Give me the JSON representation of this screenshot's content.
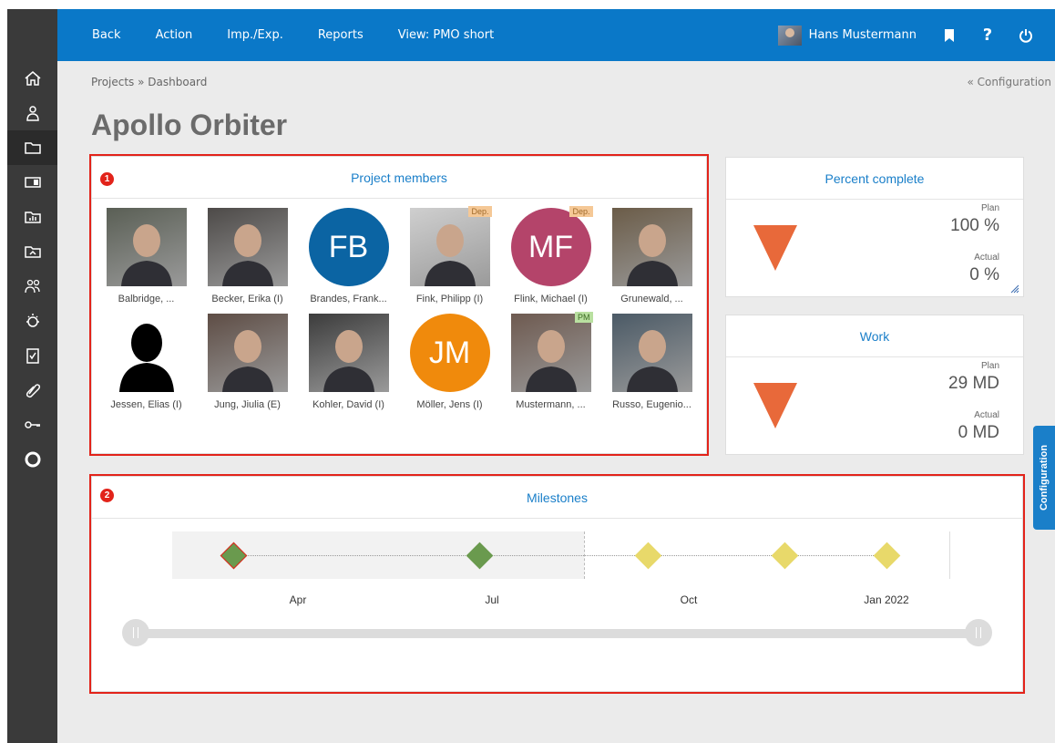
{
  "topbar": {
    "menu": [
      "Back",
      "Action",
      "Imp./Exp.",
      "Reports",
      "View: PMO short"
    ],
    "user_name": "Hans Mustermann"
  },
  "breadcrumb": "Projects  »  Dashboard",
  "config_link": "« Configuration",
  "page_title": "Apollo Orbiter",
  "members_panel": {
    "badge": "1",
    "title": "Project members",
    "members": [
      {
        "name": "Balbridge, ...",
        "type": "photo",
        "role": ""
      },
      {
        "name": "Becker, Erika (I)",
        "type": "photo",
        "role": ""
      },
      {
        "name": "Brandes, Frank...",
        "type": "initials",
        "initials": "FB",
        "color": "#0b64a3",
        "role": ""
      },
      {
        "name": "Fink, Philipp (I)",
        "type": "photo",
        "role": "Dep."
      },
      {
        "name": "Flink, Michael (I)",
        "type": "initials",
        "initials": "MF",
        "color": "#b4446a",
        "role": "Dep."
      },
      {
        "name": "Grunewald, ...",
        "type": "photo",
        "role": ""
      },
      {
        "name": "Jessen, Elias (I)",
        "type": "silhouette",
        "role": ""
      },
      {
        "name": "Jung, Jiulia (E)",
        "type": "photo",
        "role": ""
      },
      {
        "name": "Kohler, David (I)",
        "type": "photo",
        "role": ""
      },
      {
        "name": "Möller, Jens (I)",
        "type": "initials",
        "initials": "JM",
        "color": "#f08a0c",
        "role": ""
      },
      {
        "name": "Mustermann, ...",
        "type": "photo",
        "role": "PM"
      },
      {
        "name": "Russo, Eugenio...",
        "type": "photo",
        "role": ""
      }
    ]
  },
  "percent_panel": {
    "title": "Percent complete",
    "plan_label": "Plan",
    "plan_value": "100 %",
    "actual_label": "Actual",
    "actual_value": "0 %"
  },
  "work_panel": {
    "title": "Work",
    "plan_label": "Plan",
    "plan_value": "29 MD",
    "actual_label": "Actual",
    "actual_value": "0 MD"
  },
  "milestones_panel": {
    "badge": "2",
    "title": "Milestones",
    "months": [
      "Apr",
      "Jul",
      "Oct",
      "Jan 2022"
    ]
  },
  "config_tab": "Configuration",
  "icons": {
    "sidebar": [
      "home-icon",
      "person-icon",
      "folder-icon",
      "board-icon",
      "chart-folder-icon",
      "report-folder-icon",
      "team-icon",
      "idea-icon",
      "checklist-icon",
      "attachment-icon",
      "key-icon",
      "help-ring-icon"
    ],
    "top": [
      "bookmark-icon",
      "help-icon",
      "power-icon"
    ]
  }
}
